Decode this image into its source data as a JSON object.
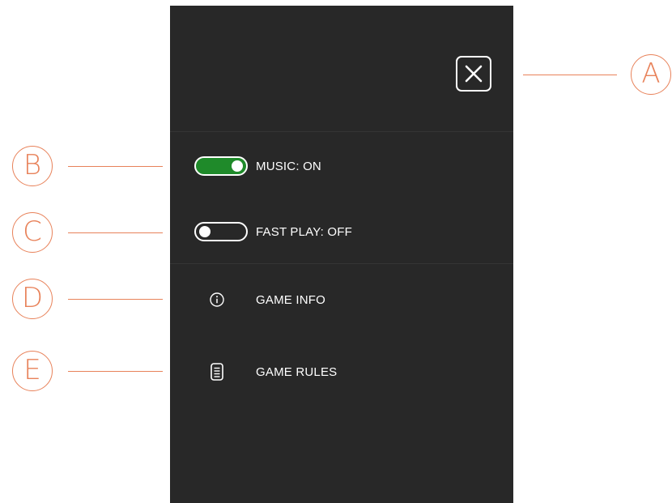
{
  "settings_menu": {
    "close_icon": "close-icon",
    "music": {
      "label": "MUSIC: ON",
      "state": "on",
      "accent_color": "#1f8a2a"
    },
    "fast_play": {
      "label": "FAST PLAY: OFF",
      "state": "off"
    },
    "game_info": {
      "label": "GAME INFO",
      "icon": "info-icon"
    },
    "game_rules": {
      "label": "GAME RULES",
      "icon": "document-icon"
    }
  },
  "callouts": {
    "a": "A",
    "b": "B",
    "c": "C",
    "d": "D",
    "e": "E",
    "color": "#e8825a"
  },
  "colors": {
    "panel_background": "#282828",
    "text": "#ffffff"
  }
}
